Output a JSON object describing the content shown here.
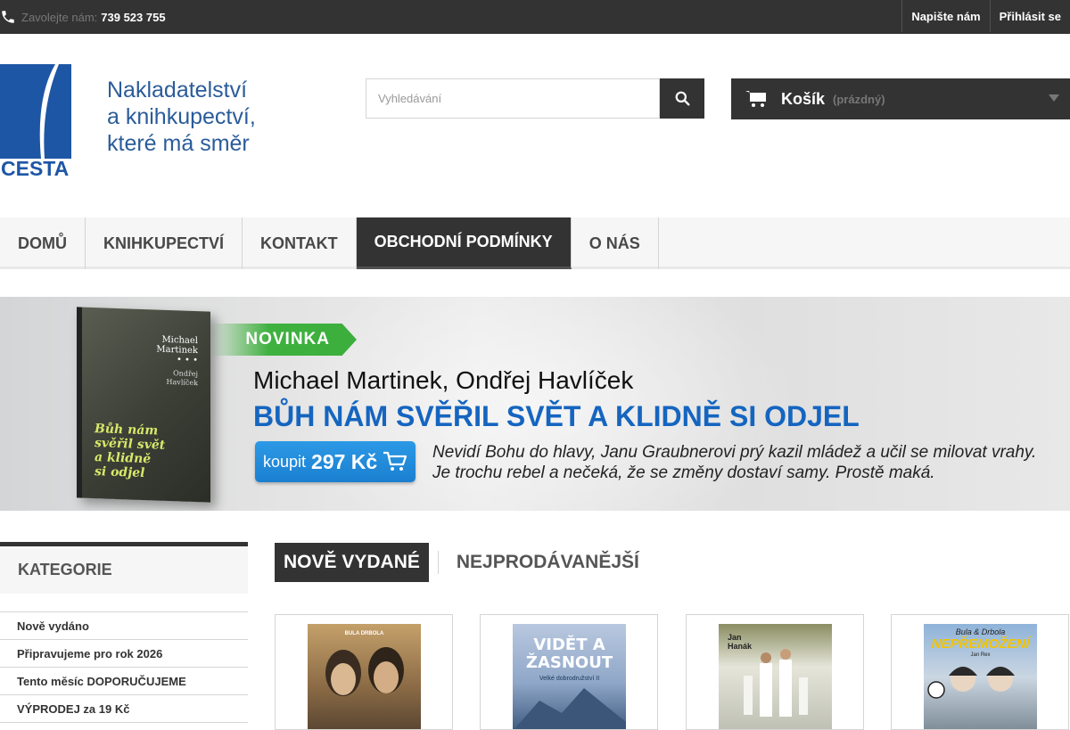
{
  "topbar": {
    "call_label": "Zavolejte nám:",
    "phone": "739 523 755",
    "contact_link": "Napište nám",
    "login_link": "Přihlásit se"
  },
  "logo": {
    "brand": "CESTA",
    "tagline": [
      "Nakladatelství",
      "a knihkupectví,",
      "které má směr"
    ]
  },
  "search": {
    "placeholder": "Vyhledávání"
  },
  "cart": {
    "label": "Košík",
    "state": "(prázdný)"
  },
  "menu": [
    {
      "label": "Domů",
      "active": false
    },
    {
      "label": "Knihkupectví",
      "active": false
    },
    {
      "label": "Kontakt",
      "active": false
    },
    {
      "label": "Obchodní podmínky",
      "active": true
    },
    {
      "label": "O nás",
      "active": false
    }
  ],
  "banner": {
    "badge": "NOVINKA",
    "authors": "Michael Martinek, Ondřej Havlíček",
    "title": "BŮH NÁM SVĚŘIL SVĚT A KLIDNĚ SI ODJEL",
    "buy_label": "koupit",
    "price": "297 Kč",
    "description": [
      "Nevidí Bohu do hlavy, Janu Graubnerovi prý kazil mládež a učil se milovat vrahy.",
      "Je trochu rebel a nečeká, že se změny dostaví samy. Prostě maká."
    ],
    "book": {
      "author1_line1": "Michael",
      "author1_line2": "Martinek",
      "author2_line1": "Ondřej",
      "author2_line2": "Havlíček",
      "title_lines": [
        "Bůh nám",
        "svěřil svět",
        "a klidně",
        "si odjel"
      ]
    }
  },
  "sidebar": {
    "heading": "Kategorie",
    "items": [
      "Nově vydáno",
      "Připravujeme pro rok 2026",
      "Tento měsíc DOPORUČUJEME",
      "VÝPRODEJ za 19 Kč"
    ]
  },
  "tabs": [
    {
      "label": "Nově vydané",
      "active": true
    },
    {
      "label": "Nejprodávanější",
      "active": false
    }
  ],
  "products": [
    {
      "cover_text": "BULA DRBOLA"
    },
    {
      "cover_text": "VIDĚT A ŽASNOUT",
      "cover_sub": "Velké dobrodružství II"
    },
    {
      "cover_text": "Jan Hanák"
    },
    {
      "cover_text": "NEPŘEMOŽENÍ",
      "cover_top": "Bula & Drbola",
      "cover_sub": "Jan Rex"
    }
  ],
  "colors": {
    "dark": "#333333",
    "accent_blue": "#1565c0",
    "novinka_green": "#3cae3c",
    "logo_blue": "#2a5c9a"
  }
}
